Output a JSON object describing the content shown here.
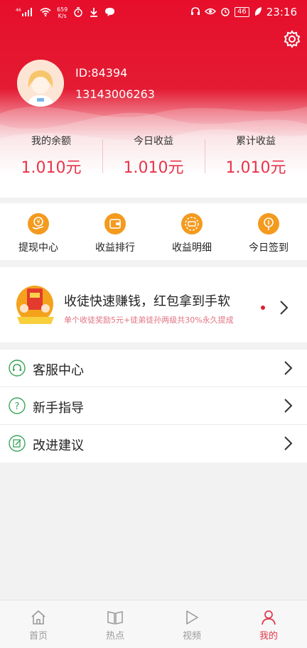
{
  "status_bar": {
    "signal": "⁴⁶",
    "net_speed_value": "659",
    "net_speed_unit": "K/s",
    "battery": "46",
    "time": "23:16"
  },
  "profile": {
    "id": "ID:84394",
    "phone": "13143006263"
  },
  "stats": [
    {
      "label": "我的余额",
      "value": "1.010元"
    },
    {
      "label": "今日收益",
      "value": "1.010元"
    },
    {
      "label": "累计收益",
      "value": "1.010元"
    }
  ],
  "actions": [
    {
      "label": "提现中心",
      "icon": "withdraw-icon"
    },
    {
      "label": "收益排行",
      "icon": "wallet-icon"
    },
    {
      "label": "收益明细",
      "icon": "detail-icon"
    },
    {
      "label": "今日签到",
      "icon": "checkin-icon"
    }
  ],
  "banner": {
    "title": "收徒快速赚钱，红包拿到手软",
    "subtitle": "单个收徒奖励5元+徒弟徒孙两级共30%永久提成"
  },
  "menu": [
    {
      "label": "客服中心",
      "icon": "headset-icon"
    },
    {
      "label": "新手指导",
      "icon": "help-icon"
    },
    {
      "label": "改进建议",
      "icon": "edit-icon"
    }
  ],
  "nav": [
    {
      "label": "首页",
      "icon": "home-icon"
    },
    {
      "label": "热点",
      "icon": "book-icon"
    },
    {
      "label": "视频",
      "icon": "play-icon"
    },
    {
      "label": "我的",
      "icon": "person-icon",
      "active": true
    }
  ],
  "colors": {
    "brand_red": "#e41b33",
    "value_red": "#e8344a",
    "icon_orange": "#f49a1e",
    "menu_icon_green": "#3aa55a"
  }
}
